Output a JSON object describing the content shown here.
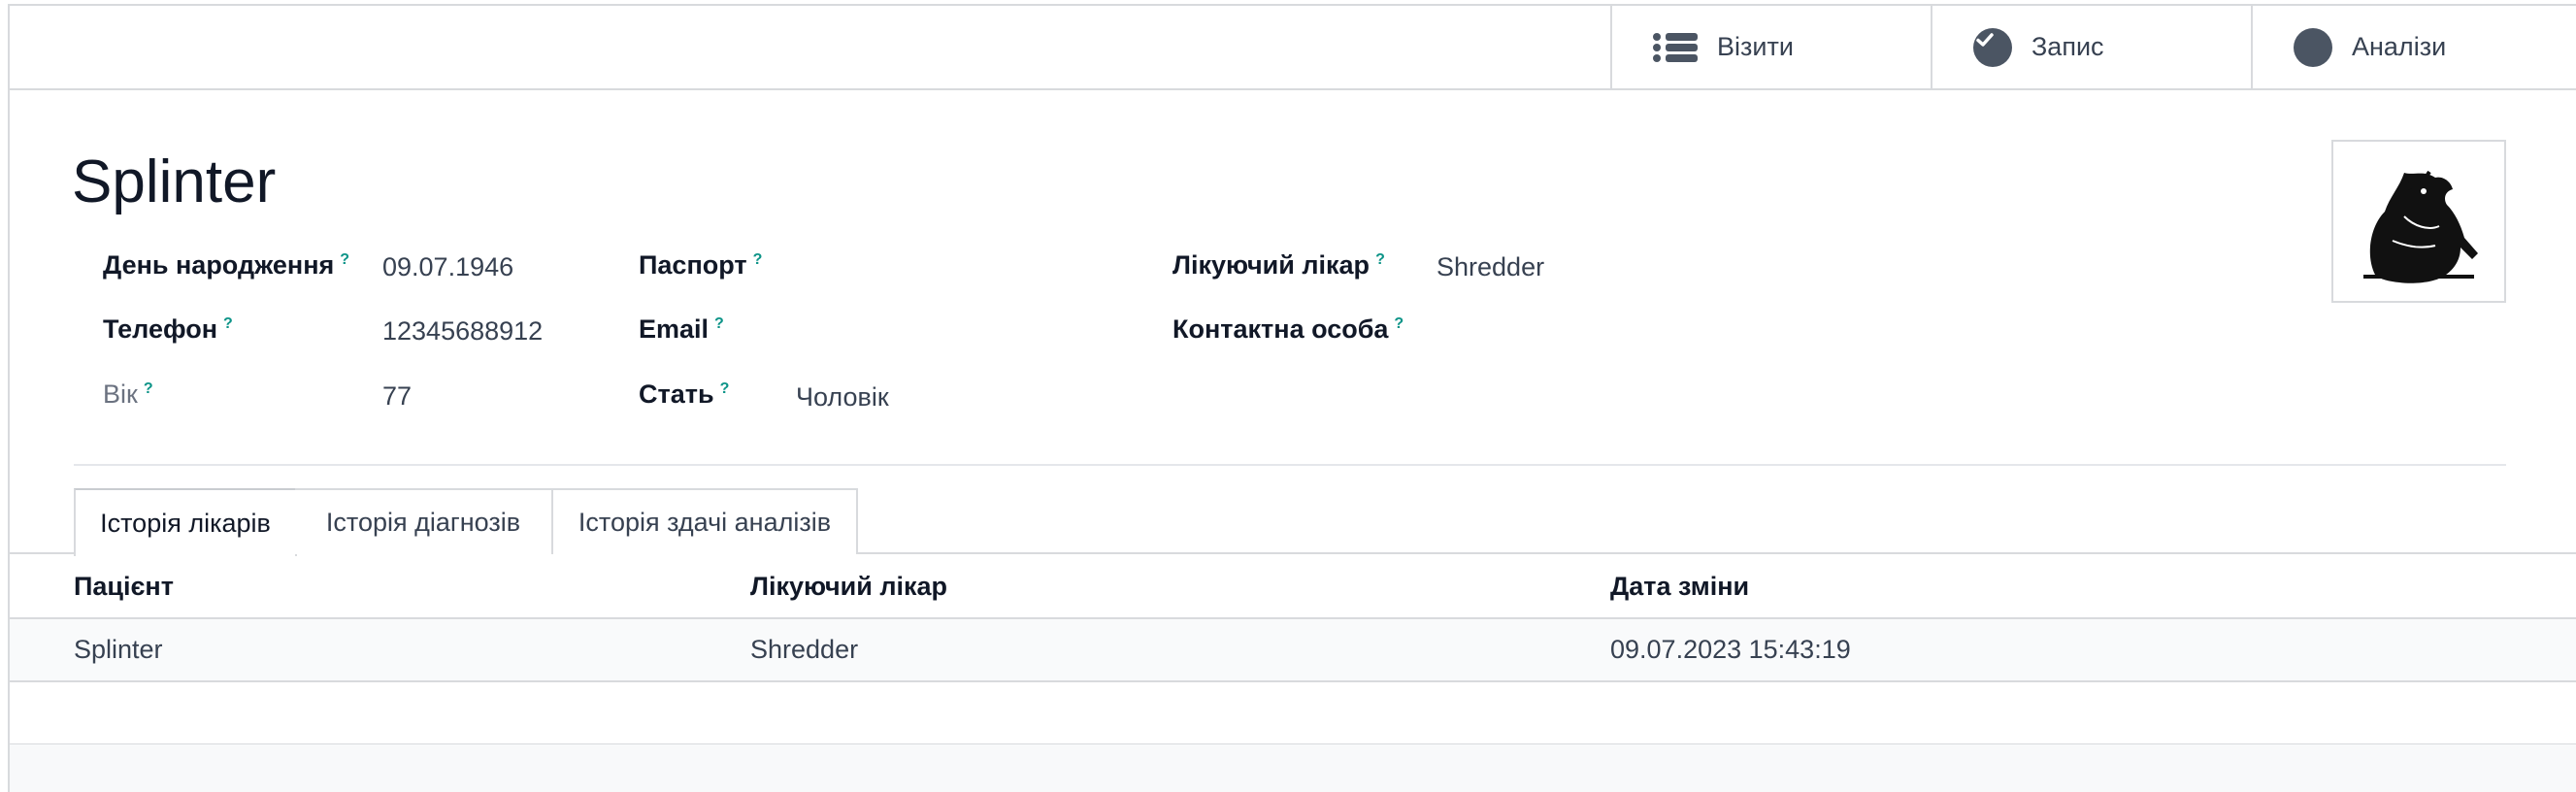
{
  "smart_buttons": [
    {
      "label": "Візити",
      "icon": "list-icon"
    },
    {
      "label": "Запис",
      "icon": "check-circle-icon"
    },
    {
      "label": "Аналізи",
      "icon": "circle-icon"
    }
  ],
  "record": {
    "title": "Splinter"
  },
  "fields": {
    "birthday": {
      "label": "День народження",
      "help": "?",
      "value": "09.07.1946"
    },
    "phone": {
      "label": "Телефон",
      "help": "?",
      "value": "12345688912"
    },
    "age": {
      "label": "Вік",
      "help": "?",
      "value": "77"
    },
    "passport": {
      "label": "Паспорт",
      "help": "?",
      "value": ""
    },
    "email": {
      "label": "Email",
      "help": "?",
      "value": ""
    },
    "gender": {
      "label": "Стать",
      "help": "?",
      "value": "Чоловік"
    },
    "doctor": {
      "label": "Лікуючий лікар",
      "help": "?",
      "value": "Shredder"
    },
    "contact": {
      "label": "Контактна особа",
      "help": "?",
      "value": ""
    }
  },
  "tabs": [
    {
      "label": "Історія лікарів",
      "active": true
    },
    {
      "label": "Історія діагнозів",
      "active": false
    },
    {
      "label": "Історія здачі аналізів",
      "active": false
    }
  ],
  "table": {
    "columns": [
      "Пацієнт",
      "Лікуючий лікар",
      "Дата зміни"
    ],
    "rows": [
      [
        "Splinter",
        "Shredder",
        "09.07.2023 15:43:19"
      ]
    ]
  }
}
